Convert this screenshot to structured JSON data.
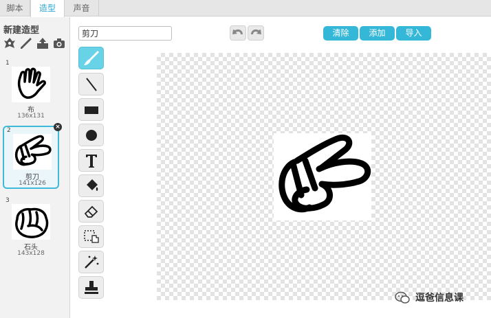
{
  "tabs": [
    {
      "label": "脚本"
    },
    {
      "label": "造型"
    },
    {
      "label": "声音"
    }
  ],
  "sidebar": {
    "new_costume_label": "新建造型",
    "new_icons": [
      "sprite-library-icon",
      "paint-brush-icon",
      "upload-icon",
      "camera-icon"
    ],
    "costumes": [
      {
        "number": "1",
        "name": "布",
        "size": "136x131",
        "selected": false
      },
      {
        "number": "2",
        "name": "剪刀",
        "size": "141x126",
        "selected": true
      },
      {
        "number": "3",
        "name": "石头",
        "size": "143x128",
        "selected": false
      }
    ],
    "delete_glyph": "×"
  },
  "editor": {
    "costume_name_value": "剪刀",
    "buttons": {
      "clear": "清除",
      "add": "添加",
      "import": "导入"
    },
    "tools": [
      "paintbrush",
      "line",
      "rectangle",
      "ellipse",
      "text",
      "fill",
      "eraser",
      "select",
      "reshape-hand",
      "stamp"
    ],
    "active_tool": "paintbrush"
  },
  "watermark": {
    "text": "逗爸信息课"
  },
  "colors": {
    "accent": "#35b8d8",
    "active_tool": "#68d2e6",
    "selected_border": "#3fb9d8"
  }
}
